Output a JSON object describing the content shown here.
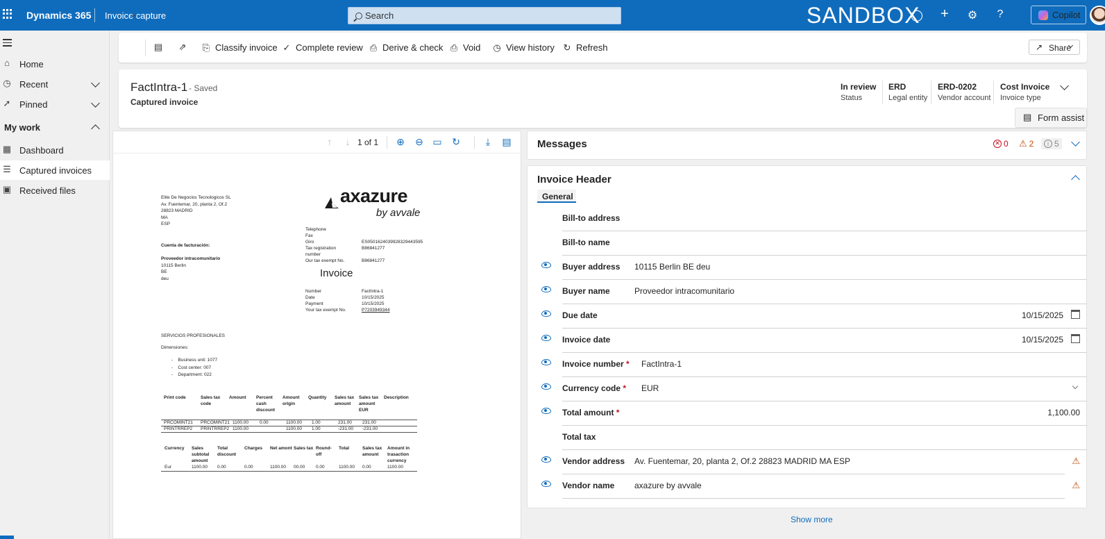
{
  "topbar": {
    "brand": "Dynamics 365",
    "module": "Invoice capture",
    "search_placeholder": "Search",
    "environment": "SANDBOX",
    "copilot_label": "Copilot"
  },
  "sidebar": {
    "items": [
      {
        "label": "Home",
        "icon": "home-icon"
      },
      {
        "label": "Recent",
        "icon": "clock-icon"
      },
      {
        "label": "Pinned",
        "icon": "pin-icon"
      },
      {
        "label": "My work",
        "icon": ""
      },
      {
        "label": "Dashboard",
        "icon": "dashboard-icon"
      },
      {
        "label": "Captured invoices",
        "icon": "list-icon"
      },
      {
        "label": "Received files",
        "icon": "image-icon"
      }
    ]
  },
  "toolbar": {
    "classify": "Classify invoice",
    "complete": "Complete review",
    "derive": "Derive & check",
    "void": "Void",
    "history": "View history",
    "refresh": "Refresh",
    "share": "Share"
  },
  "record": {
    "title": "FactIntra-1",
    "saved": "- Saved",
    "subtitle": "Captured invoice",
    "fields": [
      {
        "value": "In review",
        "label": "Status"
      },
      {
        "value": "ERD",
        "label": "Legal entity"
      },
      {
        "value": "ERD-0202",
        "label": "Vendor account"
      },
      {
        "value": "Cost Invoice",
        "label": "Invoice type"
      }
    ],
    "form_assist": "Form assist"
  },
  "viewer": {
    "page": "1 of 1"
  },
  "document": {
    "sender": [
      "Elite De Negocios Tecnologicos SL",
      "Av. Fuentemar, 20, planta 2, Of.2",
      "28823 MADRID",
      "MA",
      "ESP"
    ],
    "billing_label": "Cuenta de facturación:",
    "recipient": [
      "Proveedor intracomunitario",
      "10115 Berlin",
      "BE",
      "deu"
    ],
    "logo": "axazure",
    "logo_sub": "by avvale",
    "contact_labels": [
      "Telephone",
      "Fax",
      "Giro",
      "Tax registration",
      "number",
      "Our tax exempt No."
    ],
    "contact_values": [
      "",
      "",
      "ES0501624039928329443595",
      "B86841277",
      "",
      "B86841277"
    ],
    "invoice_title": "Invoice",
    "meta_labels": [
      "Number",
      "Date",
      "Payment",
      "Your tax exempt No."
    ],
    "meta_values": [
      "FactIntra-1",
      "10/15/2025",
      "10/15/2025",
      "P7203949344"
    ],
    "services": "SERVICIOS PROFESIONALES",
    "dims_label": "Dimensiones:",
    "dims": [
      "Business unit: 1077",
      "Cost center: 007",
      "Department: 022"
    ],
    "table1_headers": [
      "Print code",
      "Sales tax code",
      "Amount",
      "Percent cash discount",
      "Amount origin",
      "Quantity",
      "Sales tax amount",
      "Sales tax amount EUR",
      "Description"
    ],
    "table1_rows": [
      [
        "PRCOMINT21",
        "PRCOMINT21",
        "1100.00",
        "0.00",
        "1100.00",
        "1.00",
        "231.00",
        "231.00",
        ""
      ],
      [
        "PRINTRREP2",
        "PRINTRREP2",
        "1100.00",
        "",
        "1100.00",
        "1.00",
        "-231.00",
        "-231.00",
        ""
      ]
    ],
    "table2_headers": [
      "Currency",
      "Sales subtotal amount",
      "Total discount",
      "Charges",
      "Net amont",
      "Sales tax",
      "Round-off",
      "Total",
      "Sales tax amount",
      "Amount in trasaction currency"
    ],
    "table2_rows": [
      [
        "Eur",
        "1100.00",
        "0.00",
        "0.00",
        "1100.00",
        "00.00",
        "0.00",
        "1100.00",
        "0.00",
        "1100.00"
      ]
    ]
  },
  "messages": {
    "title": "Messages",
    "errors": "0",
    "warnings": "2",
    "info": "5"
  },
  "invoice_header": {
    "title": "Invoice Header",
    "tab": "General",
    "rows": [
      {
        "label": "Bill-to address",
        "value": "",
        "eye": false
      },
      {
        "label": "Bill-to name",
        "value": "",
        "eye": false
      },
      {
        "label": "Buyer address",
        "value": "10115 Berlin BE deu",
        "eye": true
      },
      {
        "label": "Buyer name",
        "value": "Proveedor intracomunitario",
        "eye": true
      },
      {
        "label": "Due date",
        "value": "10/15/2025",
        "eye": true
      },
      {
        "label": "Invoice date",
        "value": "10/15/2025",
        "eye": true
      },
      {
        "label": "Invoice number",
        "value": "FactIntra-1",
        "eye": true,
        "required": "*"
      },
      {
        "label": "Currency code",
        "value": "EUR",
        "eye": true,
        "required": "*"
      },
      {
        "label": "Total amount",
        "value": "1,100.00",
        "eye": true,
        "required": "*"
      },
      {
        "label": "Total tax",
        "value": "",
        "eye": false
      },
      {
        "label": "Vendor address",
        "value": "Av. Fuentemar, 20, planta 2, Of.2 28823 MADRID MA ESP",
        "eye": true
      },
      {
        "label": "Vendor name",
        "value": "axazure by avvale",
        "eye": true
      }
    ],
    "show_more": "Show more"
  },
  "colors": {
    "brand": "#0f6cbd",
    "error": "#c50f1f",
    "warning": "#bc4b09"
  }
}
